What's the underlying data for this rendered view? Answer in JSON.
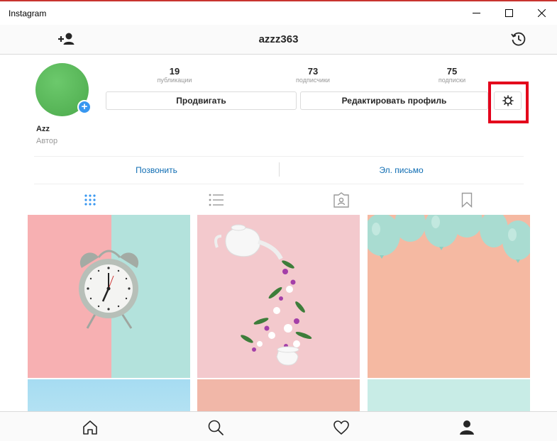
{
  "window": {
    "title": "Instagram"
  },
  "header": {
    "username": "azzz363",
    "left_icon": "add-person-icon",
    "right_icon": "archive-history-icon"
  },
  "profile": {
    "name": "Azz",
    "category": "Автор",
    "avatar_color": "#5cb85c"
  },
  "stats": [
    {
      "value": "19",
      "label": "публикации"
    },
    {
      "value": "73",
      "label": "подписчики"
    },
    {
      "value": "75",
      "label": "подписки"
    }
  ],
  "buttons": {
    "promote_label": "Продвигать",
    "edit_label": "Редактировать профиль",
    "settings_icon": "gear-icon",
    "highlight_color": "#e3001b"
  },
  "contacts": {
    "call_label": "Позвонить",
    "email_label": "Эл. письмо",
    "link_color": "#0f6db3"
  },
  "tabs": [
    {
      "name": "grid",
      "icon": "grid-icon",
      "active": true
    },
    {
      "name": "list",
      "icon": "list-icon",
      "active": false
    },
    {
      "name": "tagged",
      "icon": "tagged-photo-icon",
      "active": false
    },
    {
      "name": "saved",
      "icon": "bookmark-icon",
      "active": false
    }
  ],
  "posts": [
    {
      "subject": "alarm-clock"
    },
    {
      "subject": "teapot-flowers"
    },
    {
      "subject": "balloons"
    },
    {
      "subject": "sky"
    },
    {
      "subject": "peach"
    },
    {
      "subject": "mint"
    }
  ],
  "bottom_nav": [
    {
      "name": "home",
      "icon": "home-icon"
    },
    {
      "name": "search",
      "icon": "search-icon"
    },
    {
      "name": "activity",
      "icon": "heart-icon"
    },
    {
      "name": "profile",
      "icon": "profile-icon",
      "active": true
    }
  ],
  "accent": "#3897f0"
}
